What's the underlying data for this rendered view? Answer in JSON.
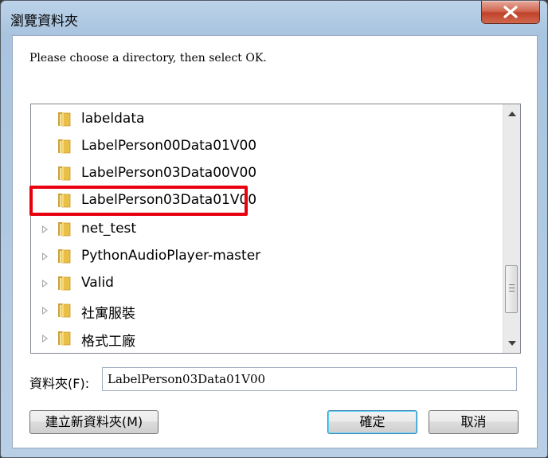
{
  "window": {
    "title": "瀏覽資料夾"
  },
  "prompt": "Please choose a directory, then select OK.",
  "tree": {
    "items": [
      {
        "label": "labeldata",
        "expandable": false
      },
      {
        "label": "LabelPerson00Data01V00",
        "expandable": false
      },
      {
        "label": "LabelPerson03Data00V00",
        "expandable": false
      },
      {
        "label": "LabelPerson03Data01V00",
        "expandable": false,
        "selected": true
      },
      {
        "label": "net_test",
        "expandable": true
      },
      {
        "label": "PythonAudioPlayer-master",
        "expandable": true
      },
      {
        "label": "Valid",
        "expandable": true
      },
      {
        "label": "社寓服裝",
        "expandable": true
      },
      {
        "label": "格式工廠",
        "expandable": true
      }
    ]
  },
  "folder_field": {
    "label": "資料夾(F):",
    "value": "LabelPerson03Data01V00"
  },
  "buttons": {
    "new_folder": "建立新資料夾(M)",
    "ok": "確定",
    "cancel": "取消"
  },
  "colors": {
    "highlight": "#e8000f",
    "folder": "#e6b93a",
    "close_button": "#c0412a"
  }
}
